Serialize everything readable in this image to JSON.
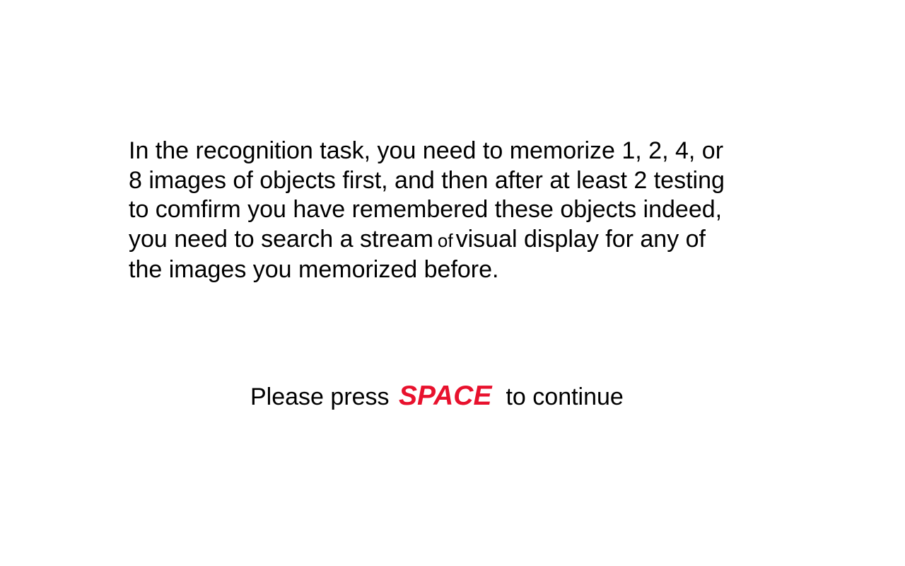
{
  "instructions": {
    "line1": "In the recognition task, you need to memorize 1, 2, 4, or",
    "line2": "8 images of objects first, and then after at least 2 testing",
    "line3": "to comfirm you have remembered these objects indeed,",
    "line4_start": "you need to search a stream",
    "line4_of": "of",
    "line4_end": "visual display for any of",
    "line5": "the images you memorized before."
  },
  "prompt": {
    "before": "Please press ",
    "key": "SPACE",
    "after": "to continue"
  },
  "colors": {
    "background": "#ffffff",
    "text": "#000000",
    "key_highlight": "#e8112d"
  }
}
